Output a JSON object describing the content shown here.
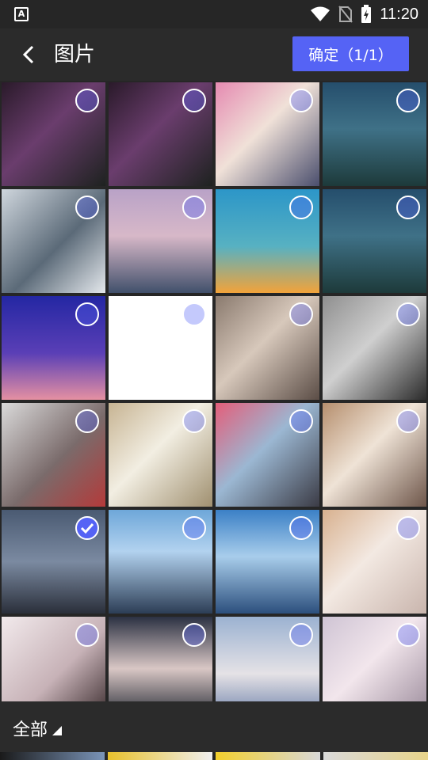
{
  "status_bar": {
    "time": "11:20",
    "app_letter": "A"
  },
  "header": {
    "title": "图片",
    "confirm_label": "确定（1/1）"
  },
  "bottom": {
    "album_label": "全部"
  },
  "colors": {
    "accent": "#5563f5",
    "bg": "#262626",
    "bar": "#2b2b2b"
  },
  "photos": [
    {
      "desc": "dark armored character",
      "bg": "linear-gradient(135deg,#2a1a2a,#6a3d6d 45%,#1e2220)",
      "selected": false,
      "icon": "purple-circle"
    },
    {
      "desc": "dark armored character",
      "bg": "linear-gradient(135deg,#2a1a2a,#6a3d6d 45%,#1e2220)",
      "selected": false,
      "icon": "purple-circle"
    },
    {
      "desc": "girl in arcade",
      "bg": "linear-gradient(135deg,#e58ab1,#f0e1d8 45%,#4a4e6d)",
      "selected": false,
      "icon": "purple-circle"
    },
    {
      "desc": "mountain lake",
      "bg": "linear-gradient(180deg,#254e6c,#3f7187 45%,#1d3a3a)",
      "selected": false,
      "icon": "purple-circle"
    },
    {
      "desc": "snowy forest",
      "bg": "linear-gradient(135deg,#cfd6dd,#5b6a78 55%,#e4e8ec)",
      "selected": false,
      "icon": "purple-circle"
    },
    {
      "desc": "lake at dusk",
      "bg": "linear-gradient(180deg,#b9a2c7,#d7b8c8 45%,#41506b)",
      "selected": false,
      "icon": "purple-circle"
    },
    {
      "desc": "tree under sky",
      "bg": "linear-gradient(180deg,#2c96c8,#57b1c2 55%,#f2a33a)",
      "selected": false,
      "icon": "purple-circle"
    },
    {
      "desc": "mountain lake",
      "bg": "linear-gradient(180deg,#254e6c,#3f7187 45%,#1d3a3a)",
      "selected": false,
      "icon": "purple-circle"
    },
    {
      "desc": "purple sky",
      "bg": "linear-gradient(180deg,#2427a3,#5a3fb6 55%,#e590a2)",
      "selected": false,
      "icon": "purple-circle"
    },
    {
      "desc": "white",
      "bg": "#ffffff",
      "selected": false,
      "icon": "purple-circle"
    },
    {
      "desc": "girl sitting on floor",
      "bg": "linear-gradient(135deg,#8a7a6e,#d7c8bb 45%,#5b4d46)",
      "selected": false,
      "icon": "purple-circle"
    },
    {
      "desc": "girl in black outfit",
      "bg": "linear-gradient(135deg,#8f8f8f,#cfcfcf 45%,#2b2b2b)",
      "selected": false,
      "icon": "purple-circle"
    },
    {
      "desc": "girl with roses",
      "bg": "linear-gradient(135deg,#dadada,#7a6b6b 55%,#b43a3a)",
      "selected": false,
      "icon": "purple-circle"
    },
    {
      "desc": "girl in white",
      "bg": "linear-gradient(135deg,#c7b493,#f2eee2 45%,#a09070)",
      "selected": false,
      "icon": "purple-circle"
    },
    {
      "desc": "girl in blue dress",
      "bg": "linear-gradient(135deg,#e45e7a,#9bb7d2 45%,#3b3b45)",
      "selected": false,
      "icon": "purple-circle"
    },
    {
      "desc": "girl in skirt",
      "bg": "linear-gradient(135deg,#b68f6e,#efe3d6 45%,#6e564a)",
      "selected": false,
      "icon": "purple-circle"
    },
    {
      "desc": "girl at harbor",
      "bg": "linear-gradient(180deg,#4a5a72,#7b8aa1 50%,#2a2f3a)",
      "selected": true,
      "icon": "purple-circle"
    },
    {
      "desc": "girl by sea",
      "bg": "linear-gradient(180deg,#6ea7d9,#b2d2ef 40%,#2c3d55)",
      "selected": false,
      "icon": "purple-circle"
    },
    {
      "desc": "girl at beach",
      "bg": "linear-gradient(180deg,#3b80c6,#a8cdeb 45%,#2c4f7d)",
      "selected": false,
      "icon": "purple-circle"
    },
    {
      "desc": "girl in knit",
      "bg": "linear-gradient(135deg,#d8b18f,#f3e9e2 45%,#c9b5ad)",
      "selected": false,
      "icon": "purple-circle"
    },
    {
      "desc": "girl in lace",
      "bg": "linear-gradient(135deg,#f2eaec,#c7b2b7 55%,#3a2b2d)",
      "selected": false,
      "icon": "purple-circle"
    },
    {
      "desc": "girl at night",
      "bg": "linear-gradient(180deg,#2b3142,#d9c7c5 50%,#1f2530)",
      "selected": false,
      "icon": "purple-circle"
    },
    {
      "desc": "girl with bangs",
      "bg": "linear-gradient(180deg,#9bb2d1,#e5e2e6 55%,#6a7fa8)",
      "selected": false,
      "icon": "purple-circle"
    },
    {
      "desc": "girl on sofa",
      "bg": "linear-gradient(135deg,#cfc4d4,#f2e6ec 45%,#9a8a9a)",
      "selected": false,
      "icon": "purple-circle"
    }
  ],
  "strip": [
    {
      "bg": "linear-gradient(90deg,#1a1a1a,#7a94b8)"
    },
    {
      "bg": "linear-gradient(90deg,#e7c02c,#f0f0f0)"
    },
    {
      "bg": "linear-gradient(90deg,#f3d02d,#d8d8d8)"
    },
    {
      "bg": "linear-gradient(90deg,#d9d9d9,#e8d48a)"
    }
  ]
}
